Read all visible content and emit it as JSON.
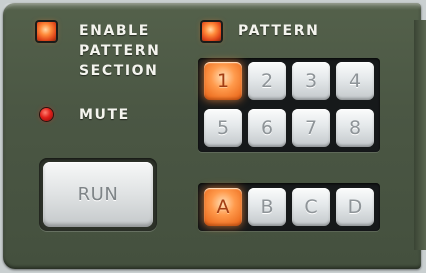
{
  "enable_section": {
    "label_lines": [
      "ENABLE",
      "PATTERN",
      "SECTION"
    ],
    "led_state": "on"
  },
  "pattern_enable": {
    "label": "PATTERN",
    "led_state": "on"
  },
  "mute": {
    "label": "MUTE",
    "led_state": "on"
  },
  "run_button": {
    "label": "RUN"
  },
  "pattern_buttons": {
    "labels": [
      "1",
      "2",
      "3",
      "4",
      "5",
      "6",
      "7",
      "8"
    ],
    "selected": "1"
  },
  "bank_buttons": {
    "labels": [
      "A",
      "B",
      "C",
      "D"
    ],
    "selected": "A"
  },
  "colors": {
    "panel": "#4b5744",
    "led_orange": "#ff8a3a",
    "led_red": "#e0201a",
    "button_lit": "#f07628",
    "button_off": "#e4e8ea"
  }
}
